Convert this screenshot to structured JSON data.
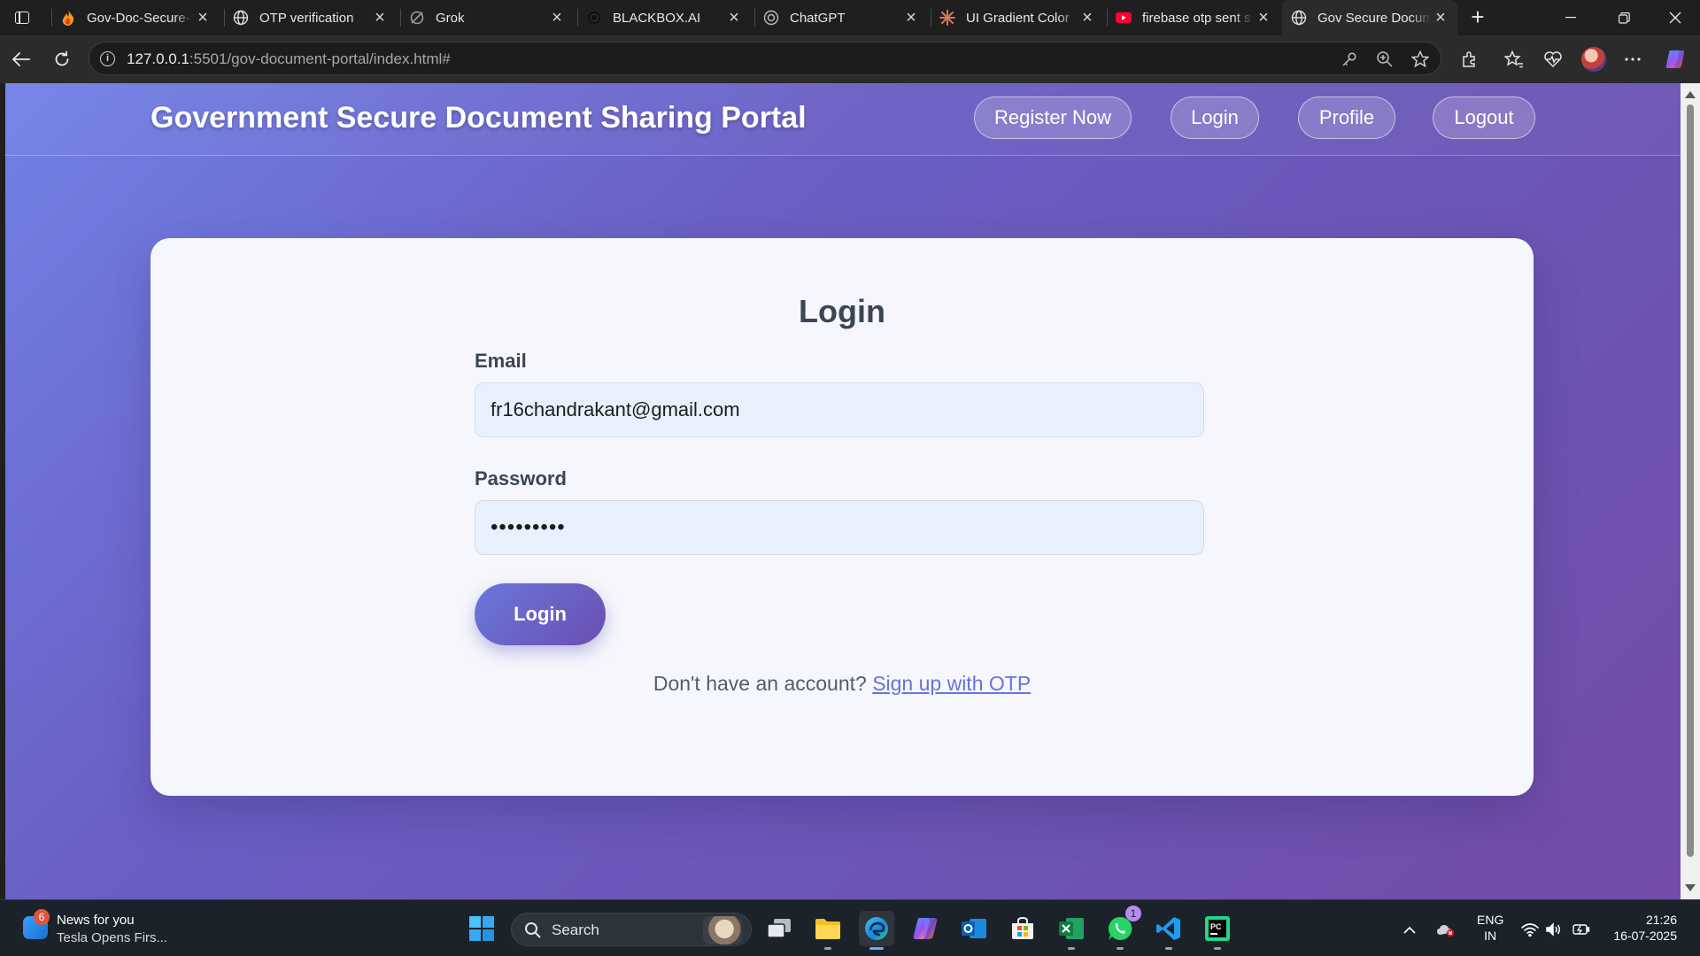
{
  "browser": {
    "tabs": [
      {
        "title": "Gov-Doc-Secure-S",
        "favicon": "fire-icon"
      },
      {
        "title": "OTP verification",
        "favicon": "globe-icon"
      },
      {
        "title": "Grok",
        "favicon": "grok-icon"
      },
      {
        "title": "BLACKBOX.AI",
        "favicon": "blackbox-icon"
      },
      {
        "title": "ChatGPT",
        "favicon": "chatgpt-icon"
      },
      {
        "title": "UI Gradient Color",
        "favicon": "claude-icon"
      },
      {
        "title": "firebase otp sent s",
        "favicon": "youtube-icon"
      },
      {
        "title": "Gov Secure Docum",
        "favicon": "globe-icon",
        "active": true
      }
    ],
    "url_host": "127.0.0.1",
    "url_rest": ":5501/gov-document-portal/index.html#"
  },
  "site": {
    "title": "Government Secure Document Sharing Portal",
    "nav": {
      "register": "Register Now",
      "login": "Login",
      "profile": "Profile",
      "logout": "Logout"
    }
  },
  "login_form": {
    "heading": "Login",
    "email_label": "Email",
    "email_value": "fr16chandrakant@gmail.com",
    "password_label": "Password",
    "password_value": "•••••••••",
    "submit_label": "Login",
    "signup_prompt": "Don't have an account?",
    "signup_link": "Sign up with OTP"
  },
  "taskbar": {
    "news_title": "News for you",
    "news_subtitle": "Tesla Opens Firs...",
    "news_badge": "6",
    "search_label": "Search",
    "whatsapp_badge": "1",
    "language_top": "ENG",
    "language_bottom": "IN",
    "time": "21:26",
    "date": "16-07-2025"
  },
  "colors": {
    "gradient_start": "#7181e6",
    "gradient_end": "#734ba8",
    "link": "#6774d6",
    "heading_text": "#3a4556"
  }
}
